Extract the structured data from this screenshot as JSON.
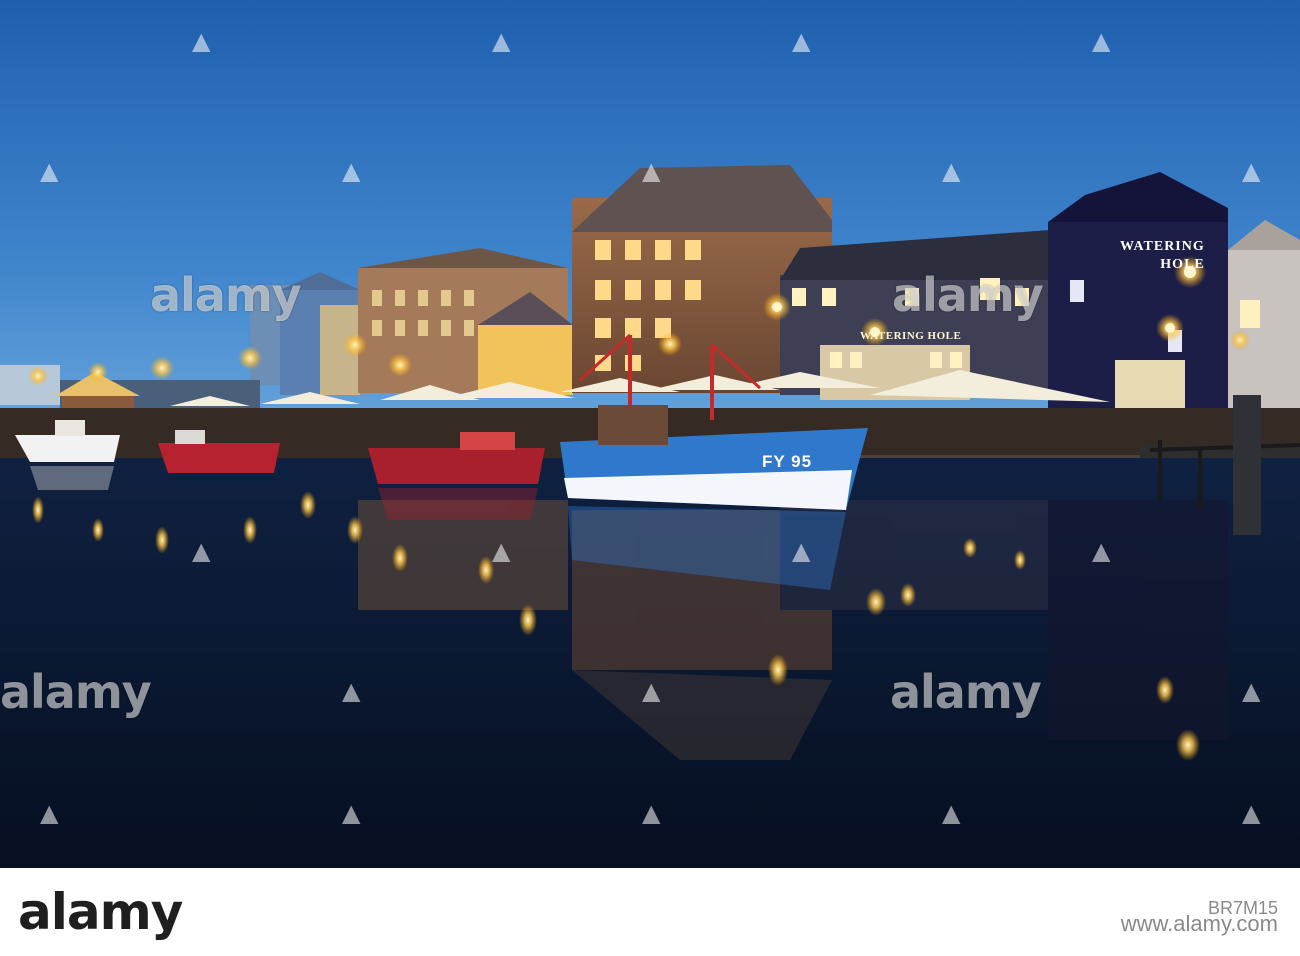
{
  "watermark": {
    "text": "alamy",
    "color": "#ffffff"
  },
  "footer": {
    "logo": "alamy",
    "image_id": "BR7M15",
    "credit_line": "www.alamy.com"
  },
  "scene": {
    "pub_sign_line1": "WATERING",
    "pub_sign_line2": "HOLE",
    "pub_facade_sign": "WATERING HOLE",
    "boat_registration": "FY 95",
    "sky_color": "#2c6db4",
    "water_color": "#0b1a33",
    "light_color": "#ffd36b"
  }
}
